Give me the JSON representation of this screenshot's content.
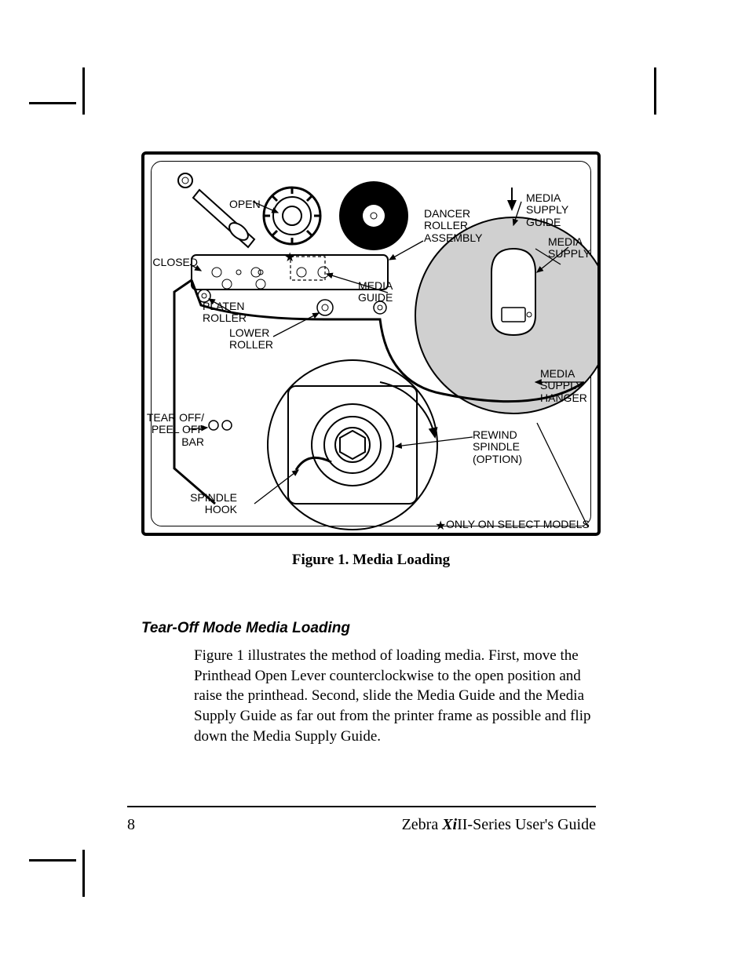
{
  "page_number": "8",
  "footer": {
    "prefix": "Zebra ",
    "em": "Xi",
    "series": "II-Series User's Guide"
  },
  "figure": {
    "caption": "Figure 1. Media Loading",
    "labels": {
      "open": "OPEN",
      "closed": "CLOSED",
      "platen_roller": "PLATEN\nROLLER",
      "lower_roller": "LOWER\nROLLER",
      "tear_peel": "TEAR OFF/\nPEEL OFF\nBAR",
      "spindle_hook": "SPINDLE\nHOOK",
      "dancer": "DANCER\nROLLER\nASSEMBLY",
      "media_guide": "MEDIA\nGUIDE",
      "media_supply_guide": "MEDIA\nSUPPLY\nGUIDE",
      "media_supply": "MEDIA\nSUPPLY",
      "media_supply_hanger": "MEDIA\nSUPPLY\nHANGER",
      "rewind": "REWIND\nSPINDLE\n(OPTION)",
      "only_select": "ONLY ON SELECT MODELS"
    }
  },
  "section_title": "Tear-Off Mode Media Loading",
  "body_text": "Figure 1 illustrates the method of loading media. First, move the Printhead Open Lever counterclockwise to the open position and raise the printhead. Second, slide the Media Guide and the Media Supply Guide as far out from the printer frame as possible and flip down the Media Supply Guide."
}
